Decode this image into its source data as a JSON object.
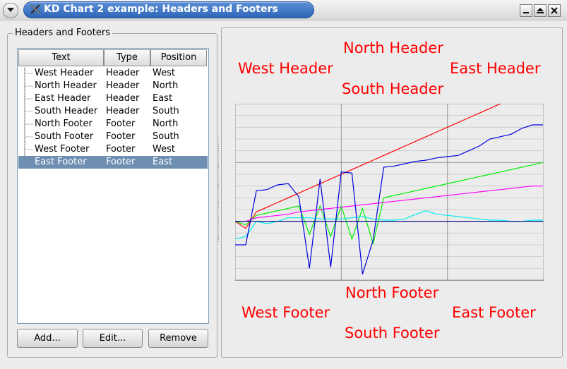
{
  "window": {
    "title": "KD Chart 2 example: Headers and Footers"
  },
  "left_panel": {
    "group_title": "Headers and Footers",
    "columns": [
      "Text",
      "Type",
      "Position"
    ],
    "rows": [
      {
        "text": "West Header",
        "type": "Header",
        "position": "West"
      },
      {
        "text": "North Header",
        "type": "Header",
        "position": "North"
      },
      {
        "text": "East Header",
        "type": "Header",
        "position": "East"
      },
      {
        "text": "South Header",
        "type": "Header",
        "position": "South"
      },
      {
        "text": "North Footer",
        "type": "Footer",
        "position": "North"
      },
      {
        "text": "South Footer",
        "type": "Footer",
        "position": "South"
      },
      {
        "text": "West Footer",
        "type": "Footer",
        "position": "West"
      },
      {
        "text": "East Footer",
        "type": "Footer",
        "position": "East"
      }
    ],
    "selected_row": 7,
    "buttons": {
      "add": "Add...",
      "edit": "Edit...",
      "remove": "Remove"
    }
  },
  "chart_labels": {
    "north_header": "North Header",
    "west_header": "West Header",
    "east_header": "East Header",
    "south_header": "South Header",
    "north_footer": "North Footer",
    "west_footer": "West Footer",
    "east_footer": "East Footer",
    "south_footer": "South Footer",
    "label_color": "#ff0000"
  },
  "chart_data": {
    "type": "line",
    "grid": true,
    "xlim": [
      0,
      29
    ],
    "ylim": [
      -5,
      10
    ],
    "series": [
      {
        "color": "#ff0000",
        "values": [
          0,
          -0.6,
          0.8,
          1.2,
          1.6,
          2,
          2.4,
          2.8,
          3.2,
          3.6,
          4,
          4.4,
          4.8,
          5.2,
          5.6,
          6,
          6.4,
          6.8,
          7.2,
          7.6,
          8,
          8.4,
          8.8,
          9.2,
          9.6,
          10,
          10.4,
          10.8,
          11.2,
          11.6
        ]
      },
      {
        "color": "#00ee00",
        "values": [
          0,
          -0.3,
          0.5,
          0.7,
          0.9,
          1.1,
          1.3,
          -1.1,
          1.3,
          -1.3,
          1.3,
          -1.5,
          1.1,
          -1.9,
          2,
          2.2,
          2.4,
          2.6,
          2.8,
          3,
          3.2,
          3.4,
          3.6,
          3.8,
          4,
          4.2,
          4.4,
          4.6,
          4.8,
          5
        ]
      },
      {
        "color": "#00eeee",
        "values": [
          -1.5,
          -1.3,
          0,
          -0.2,
          0,
          0.3,
          0.3,
          0.3,
          0.2,
          0.2,
          0.2,
          0.3,
          0.4,
          0.2,
          0.1,
          0.1,
          0.2,
          0.6,
          0.9,
          0.6,
          0.5,
          0.4,
          0.3,
          0.2,
          0.1,
          0.1,
          0,
          0,
          0.1,
          0.1
        ]
      },
      {
        "color": "#ff00ff",
        "values": [
          0,
          0,
          0.3,
          0.4,
          0.5,
          0.6,
          0.8,
          0.9,
          1,
          1.1,
          1.2,
          1.3,
          1.4,
          1.5,
          1.6,
          1.7,
          1.8,
          1.9,
          2,
          2.1,
          2.2,
          2.3,
          2.4,
          2.5,
          2.6,
          2.7,
          2.8,
          2.9,
          3,
          3
        ]
      },
      {
        "color": "#0000dd",
        "values": [
          -2,
          -2,
          2.6,
          2.7,
          3.1,
          3.2,
          2.1,
          -4,
          3.6,
          -3.9,
          4.2,
          4.1,
          -4.5,
          -1.6,
          4.6,
          4.7,
          4.9,
          5.1,
          5.2,
          5.4,
          5.5,
          5.6,
          6,
          6.4,
          7,
          7.2,
          7.4,
          7.9,
          8.2,
          8.2
        ]
      },
      {
        "color": "#00008b",
        "values": [
          0,
          0,
          0,
          0,
          0,
          0,
          0,
          0,
          0,
          0,
          0,
          0,
          0,
          0,
          0,
          0,
          0,
          0,
          0,
          0,
          0,
          0,
          0,
          0,
          0,
          0,
          0,
          0,
          0,
          0
        ]
      }
    ]
  }
}
